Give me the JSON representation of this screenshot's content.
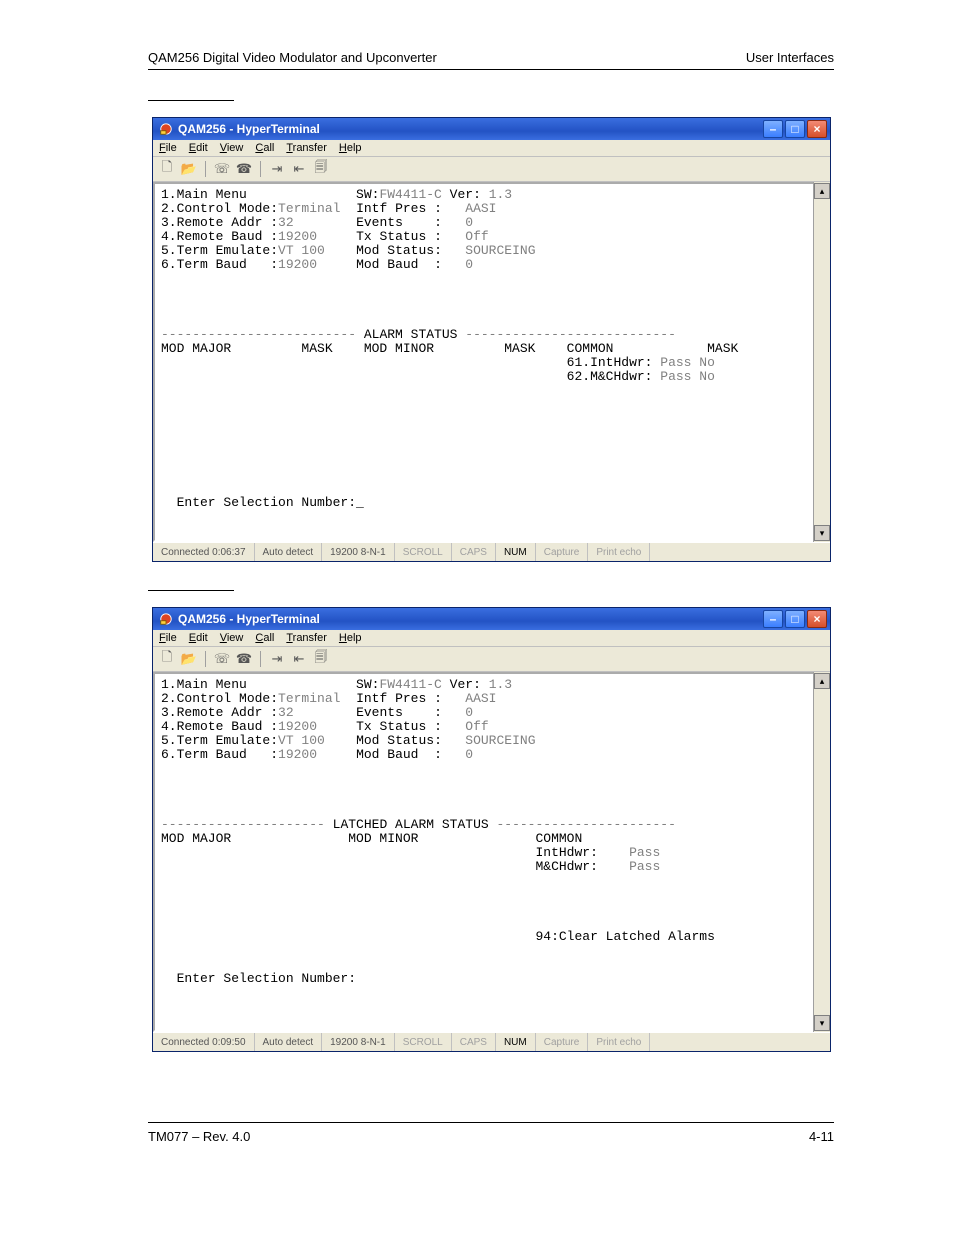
{
  "header": {
    "left": "QAM256 Digital Video Modulator and Upconverter",
    "right": "User Interfaces"
  },
  "footer": {
    "left": "TM077 – Rev. 4.0",
    "right": "4-11"
  },
  "window": {
    "title": "QAM256 - HyperTerminal",
    "menu": {
      "file": "File",
      "edit": "Edit",
      "view": "View",
      "call": "Call",
      "transfer": "Transfer",
      "help": "Help"
    }
  },
  "status1": {
    "conn": "Connected 0:06:37",
    "auto": "Auto detect",
    "baud": "19200 8-N-1",
    "scroll": "SCROLL",
    "caps": "CAPS",
    "num": "NUM",
    "capture": "Capture",
    "echo": "Print echo"
  },
  "status2": {
    "conn": "Connected 0:09:50",
    "auto": "Auto detect",
    "baud": "19200 8-N-1",
    "scroll": "SCROLL",
    "caps": "CAPS",
    "num": "NUM",
    "capture": "Capture",
    "echo": "Print echo"
  },
  "menu_block": {
    "l1_left": "1.Main Menu",
    "l1_sw": "SW:",
    "l1_swval": "FW4411-C",
    "l1_ver": " Ver: ",
    "l1_verval": "1.3",
    "l2_left": "2.Control Mode:",
    "l2_val": "Terminal",
    "l2_right": "Intf Pres :   ",
    "l2_rightval": "AASI",
    "l3_left": "3.Remote Addr :",
    "l3_val": "32",
    "l3_right": "Events    :   ",
    "l3_rightval": "0",
    "l4_left": "4.Remote Baud :",
    "l4_val": "19200",
    "l4_right": "Tx Status :   ",
    "l4_rightval": "Off",
    "l5_left": "5.Term Emulate:",
    "l5_val": "VT 100",
    "l5_right": "Mod Status:   ",
    "l5_rightval": "SOURCEING",
    "l6_left": "6.Term Baud   :",
    "l6_val": "19200",
    "l6_right": "Mod Baud  :   ",
    "l6_rightval": "0"
  },
  "alarm1": {
    "header_pre": "------------------------- ",
    "header_txt": "ALARM STATUS",
    "header_post": " ---------------------------",
    "row1": "MOD MAJOR         MASK    MOD MINOR         MASK    COMMON            MASK",
    "row2_a": "                                                    61.IntHdwr: ",
    "row2_b": "Pass No",
    "row3_a": "                                                    62.M&CHdwr: ",
    "row3_b": "Pass No"
  },
  "alarm2": {
    "header_pre": "--------------------- ",
    "header_txt": "LATCHED ALARM STATUS",
    "header_post": " -----------------------",
    "row1": "MOD MAJOR               MOD MINOR               COMMON",
    "row2_a": "                                                IntHdwr:    ",
    "row2_b": "Pass",
    "row3_a": "                                                M&CHdwr:    ",
    "row3_b": "Pass",
    "clear": "                                                94:Clear Latched Alarms"
  },
  "prompt": "  Enter Selection Number:"
}
